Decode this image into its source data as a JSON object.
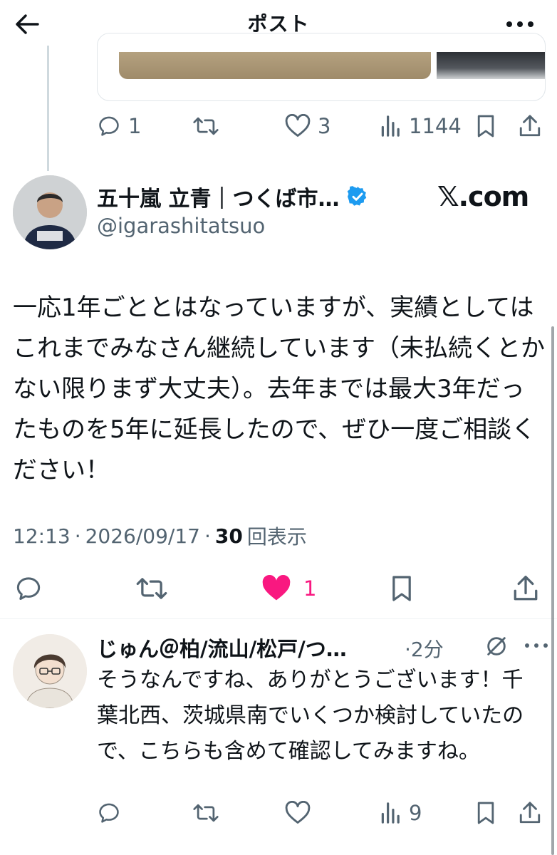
{
  "header": {
    "title": "ポスト"
  },
  "previous_post": {
    "actions": {
      "replies": "1",
      "reposts": "",
      "likes": "3",
      "views": "1144"
    }
  },
  "main_post": {
    "author_name": "五十嵐 立青｜つくば市…",
    "handle": "@igarashitatsuo",
    "watermark": "𝕏.com",
    "text": "一応1年ごととはなっていますが、実績としてはこれまでみなさん継続しています（未払続くとかない限りまず大丈夫）。去年までは最大3年だったものを5年に延長したので、ぜひ一度ご相談ください！",
    "time": "12:13",
    "date": "2026/09/17",
    "separator": "·",
    "views_count": "30",
    "views_label": "回表示",
    "likes": "1",
    "liked": true,
    "like_color": "#f91880"
  },
  "reply": {
    "author_name": "じゅん＠柏/流山/松戸/つ…",
    "time": "·2分",
    "text": "そうなんですね、ありがとうございます！千葉北西、茨城県南でいくつか検討していたので、こちらも含めて確認してみますね。",
    "actions": {
      "views": "9"
    }
  },
  "icons": {
    "back": "arrow-left-icon",
    "more": "more-horizontal-icon",
    "reply": "comment-icon",
    "repost": "repost-icon",
    "like": "heart-icon",
    "views": "analytics-icon",
    "bookmark": "bookmark-icon",
    "share": "share-icon",
    "verified": "verified-badge-icon",
    "mute": "grok-icon"
  },
  "colors": {
    "text": "#0f1419",
    "secondary": "#536471",
    "verified": "#1d9bf0",
    "like": "#f91880"
  }
}
